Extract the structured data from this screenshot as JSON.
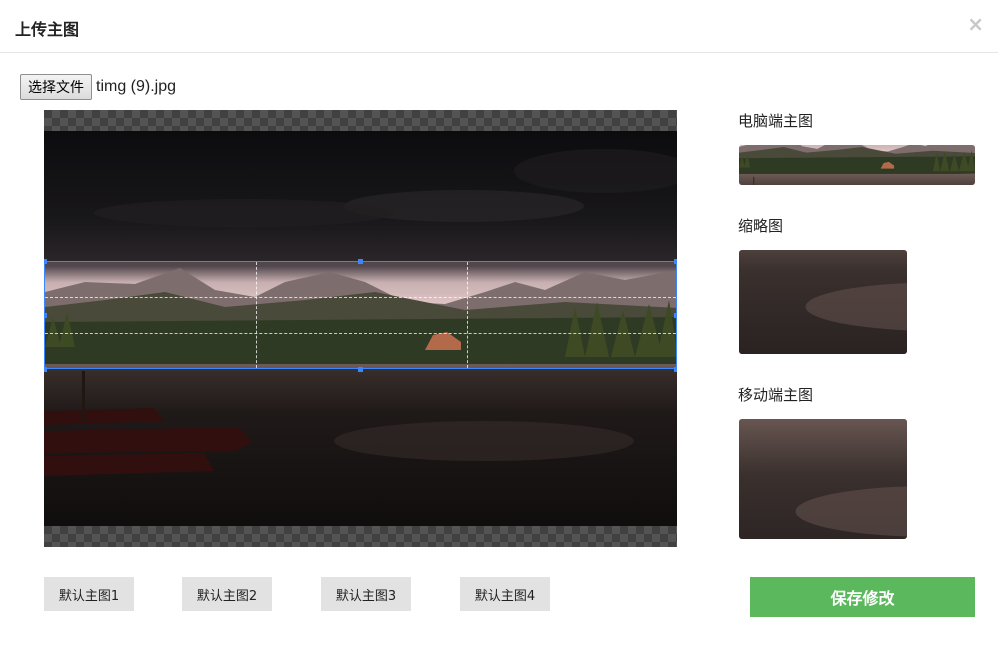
{
  "dialog": {
    "title": "上传主图",
    "close_label": "×"
  },
  "file": {
    "button_label": "选择文件",
    "file_name": "timg (9).jpg"
  },
  "previews": {
    "desktop_label": "电脑端主图",
    "thumbnail_label": "缩略图",
    "mobile_label": "移动端主图"
  },
  "defaults": {
    "buttons": [
      "默认主图1",
      "默认主图2",
      "默认主图3",
      "默认主图4"
    ]
  },
  "actions": {
    "save_label": "保存修改"
  },
  "colors": {
    "accent": "#5cb85c",
    "crop_border": "#3a86ff"
  }
}
